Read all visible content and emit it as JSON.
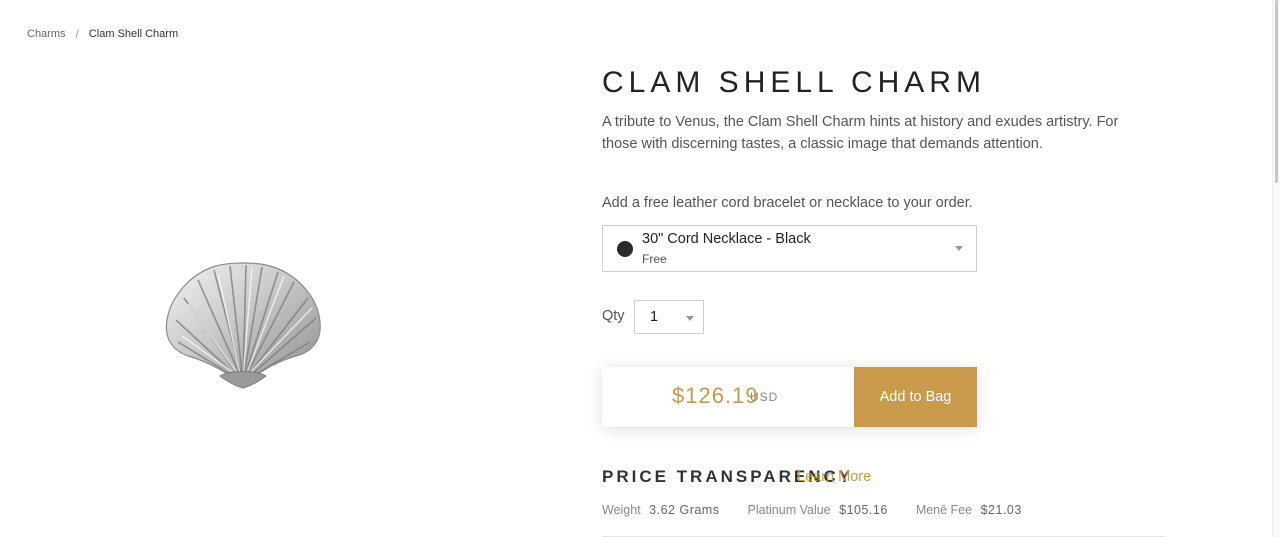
{
  "breadcrumb": {
    "parent": "Charms",
    "separator": "/",
    "current": "Clam Shell Charm"
  },
  "product": {
    "title": "CLAM SHELL CHARM",
    "description": "A tribute to Venus, the Clam Shell Charm hints at history and exudes artistry. For those with discerning tastes, a classic image that demands attention.",
    "image_icon": "clam-shell-charm-image"
  },
  "addon": {
    "label": "Add a free leather cord bracelet or necklace to your order.",
    "selected_name": "30\" Cord Necklace - Black",
    "selected_price": "Free",
    "swatch_color": "#2a2a2a"
  },
  "quantity": {
    "label": "Qty",
    "value": "1"
  },
  "purchase": {
    "price": "$126.19",
    "currency": "USD",
    "button_label": "Add to Bag",
    "accent_color": "#c99a4c"
  },
  "price_transparency": {
    "title": "PRICE TRANSPARENCY",
    "link_label": "Learn More",
    "items": [
      {
        "label": "Weight",
        "value": "3.62 Grams"
      },
      {
        "label": "Platinum Value",
        "value": "$105.16"
      },
      {
        "label": "Menē Fee",
        "value": "$21.03"
      }
    ]
  }
}
